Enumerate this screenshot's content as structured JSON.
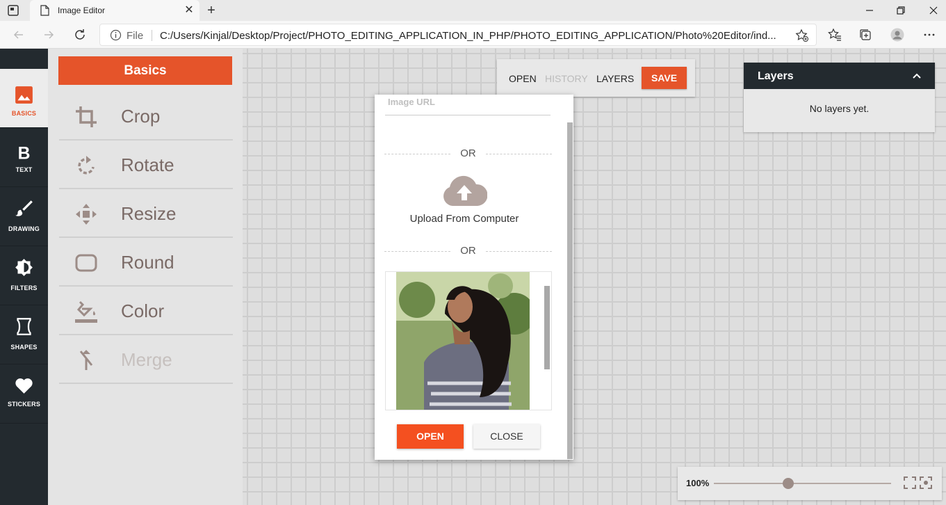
{
  "browser": {
    "tab_title": "Image Editor",
    "file_label": "File",
    "url": "C:/Users/Kinjal/Desktop/Project/PHOTO_EDITING_APPLICATION_IN_PHP/PHOTO_EDITING_APPLICATION/Photo%20Editor/ind..."
  },
  "leftnav": {
    "items": [
      {
        "label": "BASICS",
        "icon": "image-icon",
        "active": true
      },
      {
        "label": "TEXT",
        "icon": "bold-text-icon"
      },
      {
        "label": "DRAWING",
        "icon": "brush-icon"
      },
      {
        "label": "FILTERS",
        "icon": "brightness-icon"
      },
      {
        "label": "SHAPES",
        "icon": "hourglass-shape-icon"
      },
      {
        "label": "STICKERS",
        "icon": "heart-icon"
      }
    ]
  },
  "panel": {
    "title": "Basics",
    "tools": [
      {
        "label": "Crop",
        "icon": "crop-icon"
      },
      {
        "label": "Rotate",
        "icon": "rotate-icon"
      },
      {
        "label": "Resize",
        "icon": "resize-icon"
      },
      {
        "label": "Round",
        "icon": "rounded-rect-icon"
      },
      {
        "label": "Color",
        "icon": "paint-bucket-icon"
      },
      {
        "label": "Merge",
        "icon": "merge-icon",
        "disabled": true
      }
    ]
  },
  "topmenu": {
    "open": "OPEN",
    "history": "HISTORY",
    "layers": "LAYERS",
    "save": "SAVE"
  },
  "layers_panel": {
    "title": "Layers",
    "empty_text": "No layers yet."
  },
  "zoom": {
    "value_label": "100%",
    "level": 0.42
  },
  "modal": {
    "url_placeholder": "Image URL",
    "or_1": "OR",
    "upload_label": "Upload From Computer",
    "or_2": "OR",
    "open_button": "OPEN",
    "close_button": "CLOSE"
  },
  "colors": {
    "accent": "#e5542a",
    "nav_bg": "#232a2f",
    "panel_bg": "#e4e4e4",
    "icon_brown": "#9c8c87"
  }
}
